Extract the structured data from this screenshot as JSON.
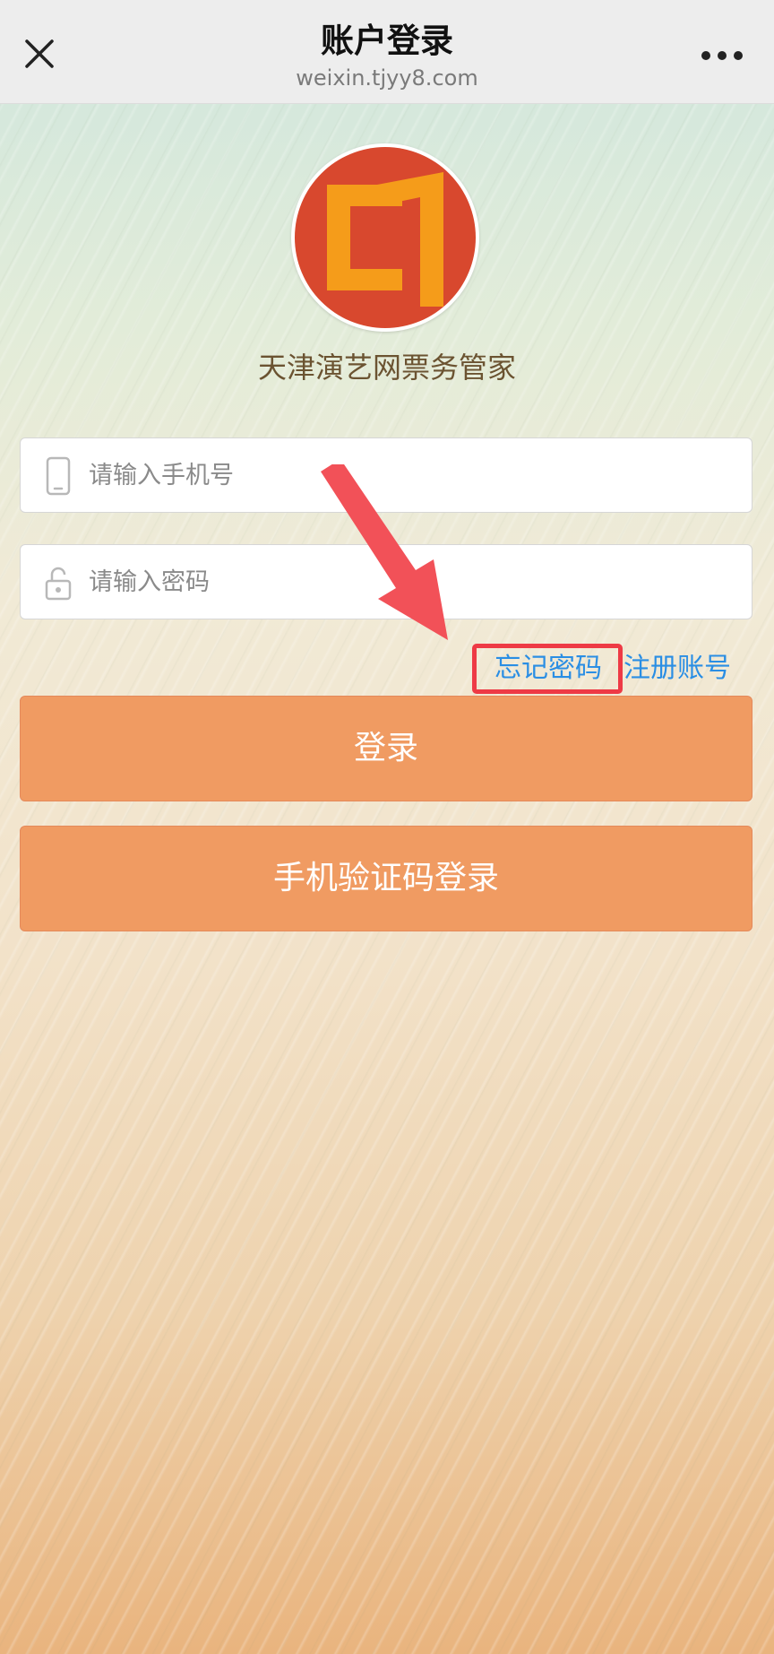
{
  "header": {
    "title": "账户登录",
    "url": "weixin.tjyy8.com",
    "close_icon": "close-icon",
    "more_icon": "more-icon"
  },
  "app": {
    "name": "天津演艺网票务管家",
    "logo_colors": {
      "background": "#d8482e",
      "glyph": "#f59c1a"
    }
  },
  "form": {
    "phone_placeholder": "请输入手机号",
    "password_placeholder": "请输入密码",
    "phone_icon": "phone-icon",
    "lock_icon": "lock-icon"
  },
  "links": {
    "forgot_password": "忘记密码",
    "register": "注册账号"
  },
  "buttons": {
    "login": "登录",
    "sms_login": "手机验证码登录"
  },
  "colors": {
    "button": "#f09b62",
    "link": "#2a8ee4",
    "highlight": "#ee3a45",
    "app_name_text": "#6b5331"
  }
}
